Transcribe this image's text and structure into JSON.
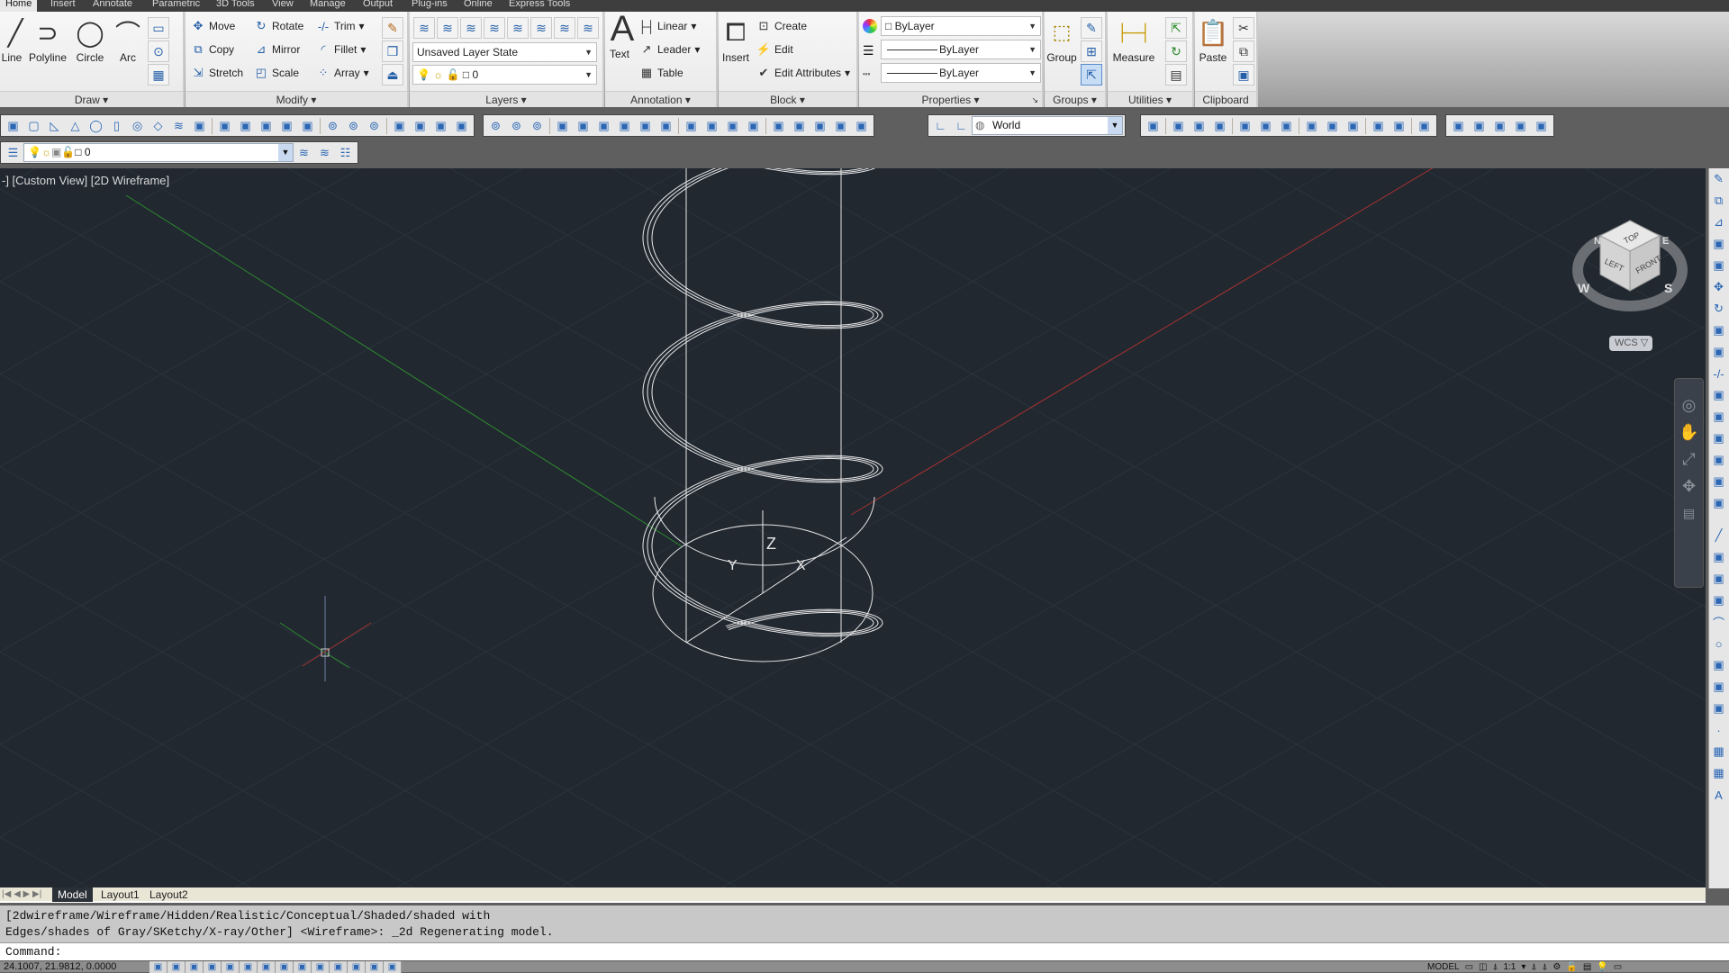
{
  "ribbon_tabs": [
    "Home",
    "Insert",
    "Annotate",
    "Parametric",
    "3D Tools",
    "View",
    "Manage",
    "Output",
    "Plug-ins",
    "Online",
    "Express Tools"
  ],
  "active_tab": "Home",
  "panels": {
    "draw": {
      "title": "Draw",
      "line": "Line",
      "polyline": "Polyline",
      "circle": "Circle",
      "arc": "Arc"
    },
    "modify": {
      "title": "Modify",
      "move": "Move",
      "rotate": "Rotate",
      "trim": "Trim",
      "copy": "Copy",
      "mirror": "Mirror",
      "fillet": "Fillet",
      "stretch": "Stretch",
      "scale": "Scale",
      "array": "Array"
    },
    "layers": {
      "title": "Layers",
      "layer_state": "Unsaved Layer State",
      "current_layer": "0"
    },
    "annotation": {
      "title": "Annotation",
      "text": "Text",
      "linear": "Linear",
      "leader": "Leader",
      "table": "Table"
    },
    "block": {
      "title": "Block",
      "insert": "Insert",
      "create": "Create",
      "edit": "Edit",
      "edit_attributes": "Edit Attributes"
    },
    "properties": {
      "title": "Properties",
      "color": "ByLayer",
      "lineweight": "ByLayer",
      "linetype": "ByLayer"
    },
    "groups": {
      "title": "Groups",
      "group": "Group"
    },
    "utilities": {
      "title": "Utilities",
      "measure": "Measure"
    },
    "clipboard": {
      "title": "Clipboard",
      "paste": "Paste"
    }
  },
  "toolbar1": {
    "modeling": [
      "polysolid",
      "box",
      "wedge",
      "cone",
      "sphere",
      "cylinder",
      "torus",
      "pyramid",
      "helix",
      "planar-surface",
      "extrude",
      "presspull",
      "sweep",
      "revolve",
      "loft",
      "union",
      "subtract",
      "intersect",
      "3d-move",
      "3d-rotate",
      "3d-align",
      "3d-array"
    ],
    "solid_edit": [
      "union",
      "subtract",
      "intersect",
      "extrude-faces",
      "move-faces",
      "offset-faces",
      "delete-faces",
      "rotate-faces",
      "taper-faces",
      "copy-faces",
      "color-faces",
      "color-edges",
      "copy-edges",
      "imprint",
      "clean",
      "separate",
      "shell",
      "check"
    ],
    "ucs_combo": "World",
    "ucs": [
      "ucs",
      "ucs-world",
      "ucs-previous",
      "ucs-face",
      "ucs-object",
      "ucs-view",
      "ucs-origin",
      "ucs-zaxis",
      "ucs-3point",
      "ucs-x",
      "ucs-y",
      "ucs-z",
      "ucs-apply"
    ],
    "measure": [
      "distance",
      "radius",
      "angle",
      "area",
      "volume"
    ]
  },
  "toolbar2": {
    "layer_value": "0",
    "icons": [
      "layer-properties",
      "make-current",
      "layer-previous",
      "layer-state"
    ]
  },
  "viewport": {
    "label": "-] [Custom View] [2D Wireframe]",
    "wcs": "WCS",
    "viewcube": {
      "top": "TOP",
      "left": "LEFT",
      "front": "FRONT",
      "compass": [
        "N",
        "E",
        "S",
        "W"
      ]
    },
    "ucs_axes": {
      "x": "X",
      "y": "Y",
      "z": "Z"
    }
  },
  "right_toolbar": [
    "erase",
    "copy",
    "mirror",
    "offset",
    "array",
    "move",
    "rotate",
    "scale",
    "stretch",
    "trim",
    "extend",
    "break",
    "join",
    "chamfer",
    "fillet",
    "explode",
    "line",
    "polyline",
    "polygon",
    "rectangle",
    "arc",
    "circle",
    "spline",
    "ellipse",
    "insert-block",
    "point",
    "hatch",
    "table",
    "text"
  ],
  "layout_tabs": [
    "Model",
    "Layout1",
    "Layout2"
  ],
  "active_layout": "Model",
  "command_history": [
    "[2dwireframe/Wireframe/Hidden/Realistic/Conceptual/Shaded/shaded with",
    "Edges/shades of Gray/SKetchy/X-ray/Other] <Wireframe>: _2d Regenerating model."
  ],
  "command_prompt": "Command:",
  "status": {
    "coordinates": "24.1007, 21.9812, 0.0000",
    "toggles": [
      "infer-constraints",
      "snap",
      "grid",
      "ortho",
      "polar",
      "osnap",
      "3d-osnap",
      "otrack",
      "ducs",
      "dyn",
      "lineweight",
      "transparency",
      "quick-properties",
      "selection-cycling"
    ],
    "model": "MODEL",
    "annotation_scale": "1:1"
  },
  "colors": {
    "viewport_bg": "#212830",
    "x_axis": "#a8322f",
    "y_axis": "#2f8a2f",
    "wireframe": "#e8e8e8"
  }
}
